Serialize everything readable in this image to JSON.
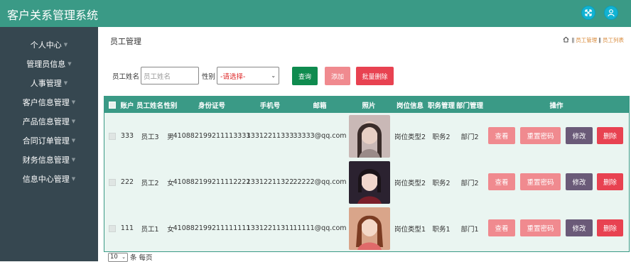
{
  "app": {
    "title": "客户关系管理系统"
  },
  "header": {
    "icons": [
      "fullscreen-icon",
      "user-icon"
    ]
  },
  "sidebar": {
    "items": [
      {
        "label": "个人中心"
      },
      {
        "label": "管理员信息"
      },
      {
        "label": "人事管理"
      },
      {
        "label": "客户信息管理"
      },
      {
        "label": "产品信息管理"
      },
      {
        "label": "合同订单管理"
      },
      {
        "label": "财务信息管理"
      },
      {
        "label": "信息中心管理"
      }
    ]
  },
  "page": {
    "title": "员工管理",
    "breadcrumb": [
      "员工管理",
      "员工列表"
    ]
  },
  "search": {
    "name_label": "员工姓名",
    "name_placeholder": "员工姓名",
    "gender_label": "性别",
    "gender_value": "-请选择-",
    "query_label": "查询",
    "add_label": "添加",
    "batch_delete_label": "批量删除"
  },
  "table": {
    "headers": {
      "account": "账户",
      "name": "员工姓名",
      "gender": "性别",
      "id_card": "身份证号",
      "phone": "手机号",
      "email": "邮箱",
      "photo": "照片",
      "position": "岗位信息",
      "duty": "职务管理",
      "dept": "部门管理",
      "actions": "操作"
    },
    "rows": [
      {
        "account": "333",
        "name": "员工3",
        "gender": "男",
        "id_card": "410882199211113333",
        "phone": "13312211333",
        "email": "33333@qq.com",
        "position": "岗位类型2",
        "duty": "职务2",
        "dept": "部门2"
      },
      {
        "account": "222",
        "name": "员工2",
        "gender": "女",
        "id_card": "410882199211112222",
        "phone": "13312211322",
        "email": "22222@qq.com",
        "position": "岗位类型2",
        "duty": "职务2",
        "dept": "部门2"
      },
      {
        "account": "111",
        "name": "员工1",
        "gender": "女",
        "id_card": "410882199211111111",
        "phone": "13312211311",
        "email": "11111@qq.com",
        "position": "岗位类型1",
        "duty": "职务1",
        "dept": "部门1"
      }
    ],
    "actions": {
      "view": "查看",
      "reset": "重置密码",
      "edit": "修改",
      "delete": "删除"
    }
  },
  "pager": {
    "page_size": "10",
    "suffix": "条 每页"
  },
  "colors": {
    "primary": "#3a9a86",
    "sidebar": "#364750",
    "danger": "#e84251",
    "pink": "#f08a8f",
    "purple": "#6a5a78",
    "success": "#0f8b4f"
  }
}
